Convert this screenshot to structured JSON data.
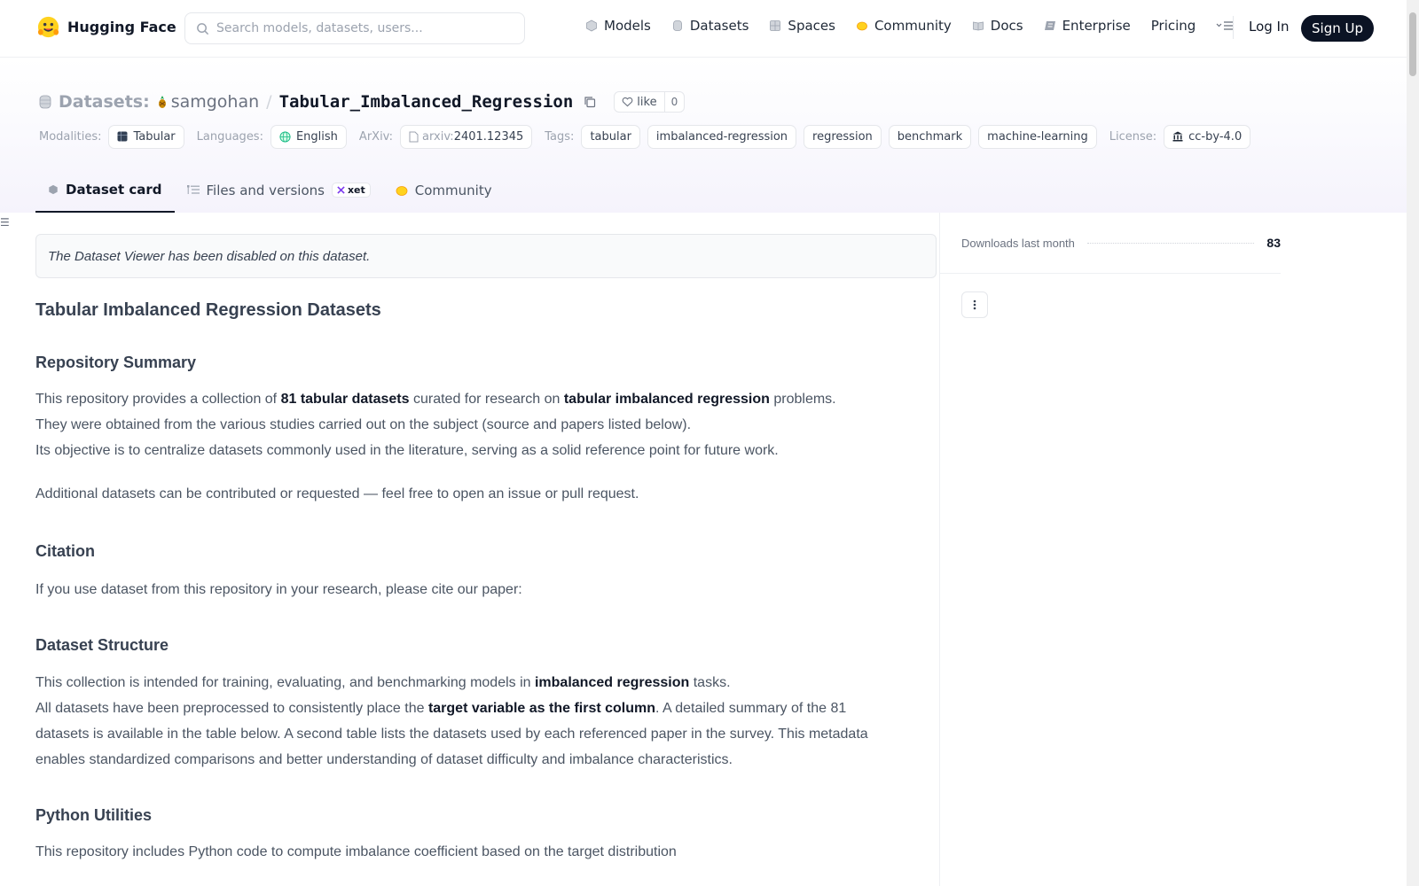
{
  "nav": {
    "brand": "Hugging Face",
    "search_placeholder": "Search models, datasets, users...",
    "links": [
      {
        "label": "Models",
        "icon": "cube-icon"
      },
      {
        "label": "Datasets",
        "icon": "database-icon"
      },
      {
        "label": "Spaces",
        "icon": "grid-icon"
      },
      {
        "label": "Community",
        "icon": "hands-icon"
      },
      {
        "label": "Docs",
        "icon": "book-icon"
      },
      {
        "label": "Enterprise",
        "icon": "enterprise-icon"
      },
      {
        "label": "Pricing"
      }
    ],
    "login": "Log In",
    "signup": "Sign Up"
  },
  "header": {
    "type_label": "Datasets:",
    "owner": "samgohan",
    "separator": "/",
    "repo": "Tabular_Imbalanced_Regression",
    "like_label": "like",
    "like_count": "0"
  },
  "meta": {
    "modalities_label": "Modalities:",
    "modality": "Tabular",
    "languages_label": "Languages:",
    "language": "English",
    "arxiv_label": "ArXiv:",
    "arxiv_prefix": "arxiv:",
    "arxiv_id": "2401.12345",
    "tags_label": "Tags:",
    "tags": [
      "tabular",
      "imbalanced-regression",
      "regression",
      "benchmark",
      "machine-learning"
    ],
    "license_label": "License:",
    "license": "cc-by-4.0"
  },
  "tabs": [
    {
      "label": "Dataset card",
      "active": true
    },
    {
      "label": "Files and versions",
      "badge": "xet"
    },
    {
      "label": "Community"
    }
  ],
  "card": {
    "viewer_note": "The Dataset Viewer has been disabled on this dataset.",
    "title": "Tabular Imbalanced Regression Datasets",
    "summary_heading": "Repository Summary",
    "summary_p1_a": "This repository provides a collection of ",
    "summary_p1_b": "81 tabular datasets",
    "summary_p1_c": " curated for research on ",
    "summary_p1_d": "tabular imbalanced regression",
    "summary_p1_e": " problems. They were obtained from the various studies carried out on the subject (source and papers listed below).",
    "summary_p1_f": "Its objective is to centralize datasets commonly used in the literature, serving as a solid reference point for future work.",
    "summary_p2": "Additional datasets can be contributed or requested — feel free to open an issue or pull request.",
    "citation_heading": "Citation",
    "citation_p": "If you use dataset from this repository in your research, please cite our paper:",
    "structure_heading": "Dataset Structure",
    "structure_p1_a": "This collection is intended for training, evaluating, and benchmarking models in ",
    "structure_p1_b": "imbalanced regression",
    "structure_p1_c": " tasks.",
    "structure_p2_a": "All datasets have been preprocessed to consistently place the ",
    "structure_p2_b": "target variable as the first column",
    "structure_p2_c": ". A detailed summary of the 81 datasets is available in the table below. A second table lists the datasets used by each referenced paper in the survey. This metadata enables standardized comparisons and better understanding of dataset difficulty and imbalance characteristics.",
    "utilities_heading": "Python Utilities",
    "utilities_p": "This repository includes Python code to compute imbalance coefficient based on the target distribution"
  },
  "sidebar": {
    "downloads_label": "Downloads last month",
    "downloads_count": "83"
  }
}
